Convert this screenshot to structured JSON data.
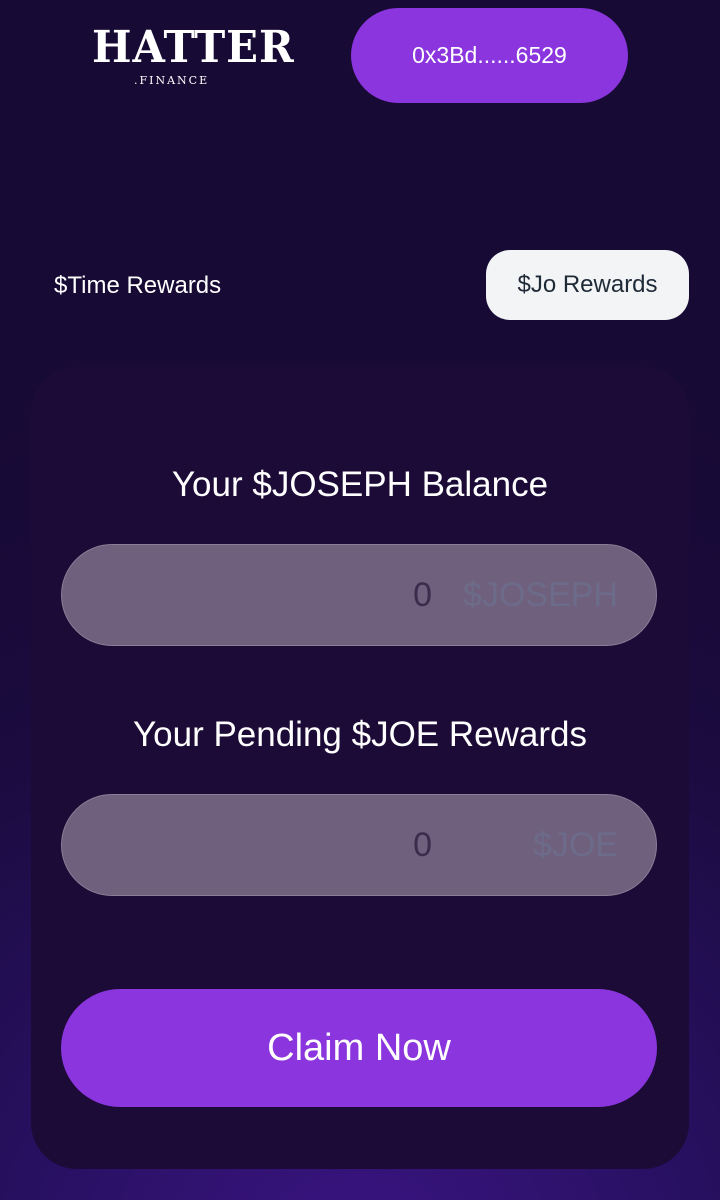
{
  "header": {
    "logo_main": "HATTER",
    "logo_sub": ".FINANCE",
    "wallet_address": "0x3Bd......6529"
  },
  "tabs": {
    "time_rewards": "$Time Rewards",
    "jo_rewards": "$Jo Rewards",
    "active": "jo_rewards"
  },
  "card": {
    "balance_label": "Your $JOSEPH Balance",
    "balance_value": "0",
    "balance_unit": "$JOSEPH",
    "pending_label": "Your Pending $JOE Rewards",
    "pending_value": "0",
    "pending_unit": "$JOE",
    "claim_label": "Claim Now"
  },
  "colors": {
    "accent": "#8a35dd",
    "background": "#1b0b3f",
    "card": "#1c0b36",
    "field": "#6f607d",
    "active_tab": "#f3f4f6"
  }
}
